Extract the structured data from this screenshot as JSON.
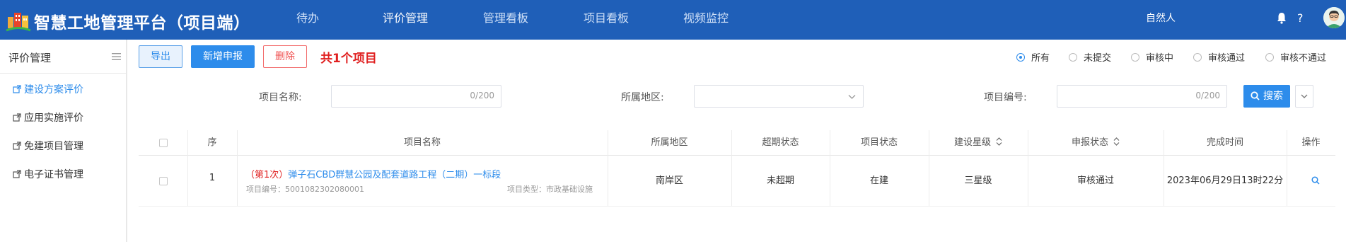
{
  "header": {
    "app_title": "智慧工地管理平台（项目端）",
    "nav": [
      "待办",
      "评价管理",
      "管理看板",
      "项目看板",
      "视频监控"
    ],
    "active_nav": "评价管理",
    "user_name": "自然人",
    "help": "?"
  },
  "sidebar": {
    "title": "评价管理",
    "items": [
      {
        "label": "建设方案评价",
        "active": true
      },
      {
        "label": "应用实施评价",
        "active": false
      },
      {
        "label": "免建项目管理",
        "active": false
      },
      {
        "label": "电子证书管理",
        "active": false
      }
    ]
  },
  "toolbar": {
    "export_label": "导出",
    "add_label": "新增申报",
    "delete_label": "删除",
    "project_count": "共1个项目",
    "status_filters": [
      {
        "label": "所有",
        "checked": true
      },
      {
        "label": "未提交",
        "checked": false
      },
      {
        "label": "审核中",
        "checked": false
      },
      {
        "label": "审核通过",
        "checked": false
      },
      {
        "label": "审核不通过",
        "checked": false
      }
    ]
  },
  "filters": {
    "project_name_label": "项目名称:",
    "project_name_value": "",
    "project_name_counter": "0/200",
    "region_label": "所属地区:",
    "region_value": "",
    "project_code_label": "项目编号:",
    "project_code_value": "",
    "project_code_counter": "0/200",
    "search_label": "搜索"
  },
  "table": {
    "columns": [
      "序",
      "项目名称",
      "所属地区",
      "超期状态",
      "项目状态",
      "建设星级",
      "申报状态",
      "完成时间",
      "操作"
    ],
    "rows": [
      {
        "index": "1",
        "times": "（第1次）",
        "name": "弹子石CBD群慧公园及配套道路工程（二期）一标段",
        "code": "项目编号：5001082302080001",
        "type": "项目类型：市政基础设施",
        "region": "南岸区",
        "overdue": "未超期",
        "status": "在建",
        "star": "三星级",
        "report_status": "审核通过",
        "finish_time": "2023年06月29日13时22分"
      }
    ]
  },
  "colors": {
    "header_bg": "#1f5fb8",
    "primary": "#2d8ceb",
    "danger": "#e02020"
  }
}
